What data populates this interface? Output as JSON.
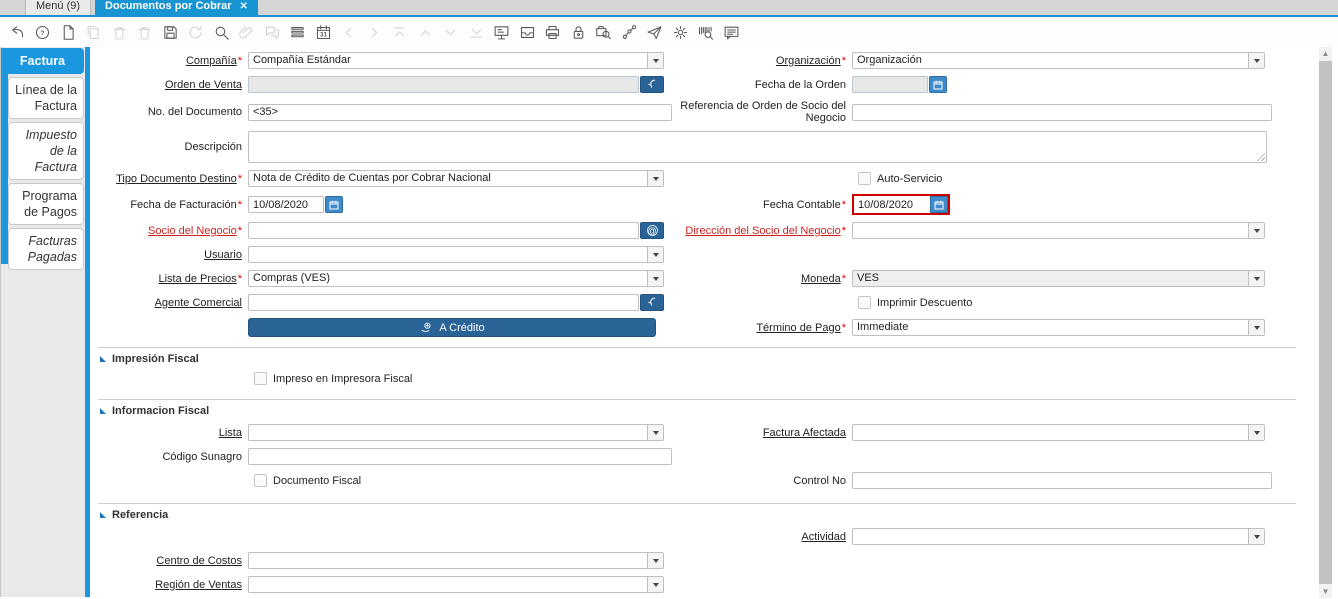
{
  "window": {
    "tabs": [
      {
        "label": "Menú (9)"
      },
      {
        "label": "Documentos por Cobrar",
        "close_icon": "✕"
      }
    ]
  },
  "toolbar": {
    "icons": [
      {
        "name": "undo-icon",
        "enabled": true
      },
      {
        "name": "help-icon",
        "enabled": true
      },
      {
        "name": "new-record-icon",
        "enabled": true
      },
      {
        "name": "copy-record-icon",
        "enabled": false
      },
      {
        "name": "delete-record-icon",
        "enabled": false
      },
      {
        "name": "delete-selection-icon",
        "enabled": false
      },
      {
        "name": "save-icon",
        "enabled": true
      },
      {
        "name": "refresh-icon",
        "enabled": false
      },
      {
        "name": "find-icon",
        "enabled": true
      },
      {
        "name": "attachment-icon",
        "enabled": false
      },
      {
        "name": "chat-icon",
        "enabled": false
      },
      {
        "name": "grid-toggle-icon",
        "enabled": true
      },
      {
        "name": "calendar-icon",
        "enabled": true
      },
      {
        "name": "parent-record-icon",
        "enabled": false
      },
      {
        "name": "detail-record-icon",
        "enabled": false
      },
      {
        "name": "first-record-icon",
        "enabled": false
      },
      {
        "name": "previous-record-icon",
        "enabled": false
      },
      {
        "name": "next-record-icon",
        "enabled": false
      },
      {
        "name": "last-record-icon",
        "enabled": false
      },
      {
        "name": "report-icon",
        "enabled": true
      },
      {
        "name": "archive-icon",
        "enabled": true
      },
      {
        "name": "print-icon",
        "enabled": true
      },
      {
        "name": "lock-icon",
        "enabled": true
      },
      {
        "name": "zoom-across-icon",
        "enabled": true
      },
      {
        "name": "workflow-icon",
        "enabled": true
      },
      {
        "name": "send-mail-icon",
        "enabled": true
      },
      {
        "name": "preferences-icon",
        "enabled": true
      },
      {
        "name": "product-info-icon",
        "enabled": true
      },
      {
        "name": "comments-icon",
        "enabled": true
      }
    ]
  },
  "sidebar": {
    "items": [
      {
        "label": "Factura",
        "active": true
      },
      {
        "label": "Línea de la Factura"
      },
      {
        "label": "Impuesto de la Factura",
        "italic": true
      },
      {
        "label": "Programa de Pagos"
      },
      {
        "label": "Facturas Pagadas",
        "italic": true
      }
    ]
  },
  "ui": {
    "required_marker": "*"
  },
  "colors": {
    "accent_blue": "#1794d2",
    "button_blue": "#2a6395",
    "focus_red": "#cc0000"
  },
  "fields": {
    "compania": {
      "label": "Compañía",
      "value": "Compañía Estándar"
    },
    "organizacion": {
      "label": "Organización",
      "value": "Organización"
    },
    "orden_venta": {
      "label": "Orden de Venta",
      "value": ""
    },
    "fecha_orden": {
      "label": "Fecha de la Orden",
      "value": ""
    },
    "no_documento": {
      "label": "No. del Documento",
      "value": "<35>"
    },
    "ref_orden_socio": {
      "label": "Referencia de Orden de Socio del Negocio",
      "value": ""
    },
    "descripcion": {
      "label": "Descripción",
      "value": ""
    },
    "tipo_doc_destino": {
      "label": "Tipo Documento Destino",
      "value": "Nota de Crédito de Cuentas por Cobrar Nacional"
    },
    "auto_servicio": {
      "label": "Auto-Servicio",
      "checked": false
    },
    "fecha_facturacion": {
      "label": "Fecha de Facturación",
      "value": "10/08/2020"
    },
    "fecha_contable": {
      "label": "Fecha Contable",
      "value": "10/08/2020"
    },
    "socio_negocio": {
      "label": "Socio del Negocio",
      "value": ""
    },
    "direccion_socio": {
      "label": "Dirección del Socio del Negocio",
      "value": ""
    },
    "usuario": {
      "label": "Usuario",
      "value": ""
    },
    "lista_precios": {
      "label": "Lista de Precios",
      "value": "Compras (VES)"
    },
    "moneda": {
      "label": "Moneda",
      "value": "VES"
    },
    "agente_comercial": {
      "label": "Agente Comercial",
      "value": ""
    },
    "imprimir_descuento": {
      "label": "Imprimir Descuento",
      "checked": false
    },
    "a_credito": {
      "label": "A Crédito"
    },
    "termino_pago": {
      "label": "Término de Pago",
      "value": "Immediate"
    }
  },
  "sections": {
    "impresion_fiscal": {
      "title": "Impresión Fiscal",
      "impreso_impresora": {
        "label": "Impreso en Impresora Fiscal",
        "checked": false
      }
    },
    "informacion_fiscal": {
      "title": "Informacion Fiscal",
      "lista": {
        "label": "Lista",
        "value": ""
      },
      "factura_afectada": {
        "label": "Factura Afectada",
        "value": ""
      },
      "codigo_sunagro": {
        "label": "Código Sunagro",
        "value": ""
      },
      "documento_fiscal": {
        "label": "Documento Fiscal",
        "checked": false
      },
      "control_no": {
        "label": "Control No",
        "value": ""
      }
    },
    "referencia": {
      "title": "Referencia",
      "actividad": {
        "label": "Actividad",
        "value": ""
      },
      "centro_costos": {
        "label": "Centro de Costos",
        "value": ""
      },
      "region_ventas": {
        "label": "Región de Ventas",
        "value": ""
      }
    }
  }
}
